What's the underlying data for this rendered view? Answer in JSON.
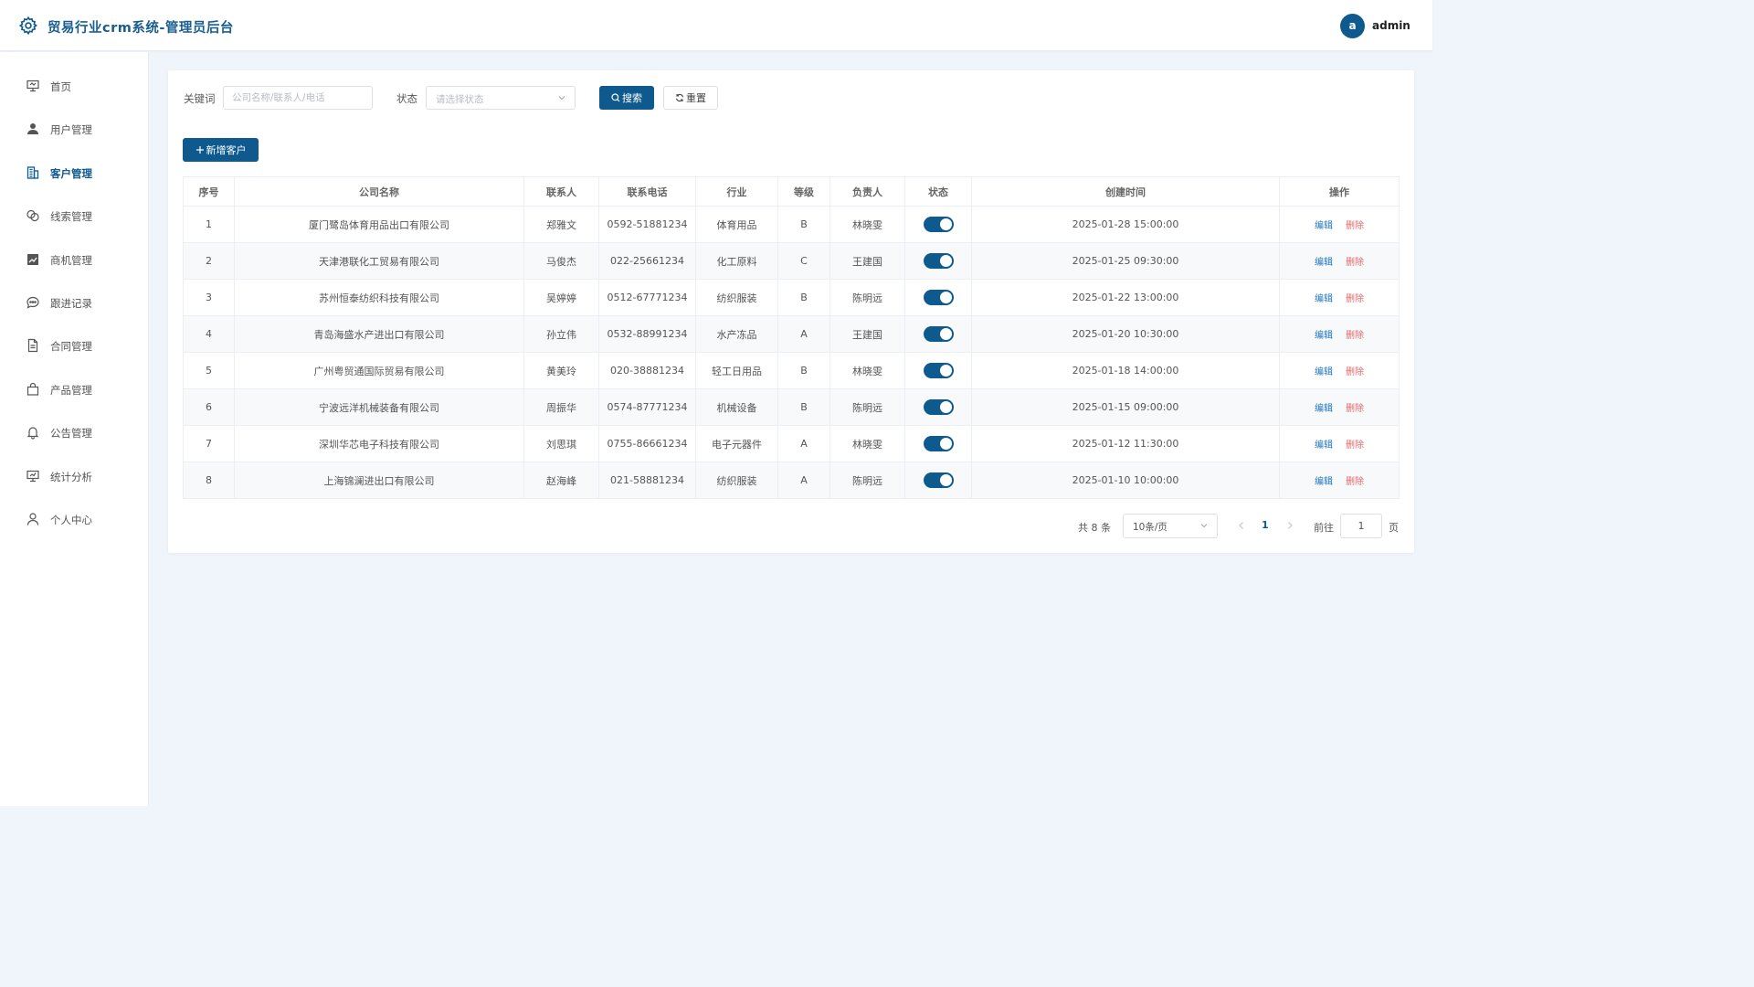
{
  "header": {
    "title": "贸易行业crm系统-管理员后台",
    "avatar_letter": "a",
    "username": "admin"
  },
  "sidebar": {
    "items": [
      {
        "label": "首页",
        "icon": "home-icon"
      },
      {
        "label": "用户管理",
        "icon": "user-icon"
      },
      {
        "label": "客户管理",
        "icon": "building-icon",
        "active": true
      },
      {
        "label": "线索管理",
        "icon": "clue-icon"
      },
      {
        "label": "商机管理",
        "icon": "trend-chart-icon"
      },
      {
        "label": "跟进记录",
        "icon": "chat-icon"
      },
      {
        "label": "合同管理",
        "icon": "document-icon"
      },
      {
        "label": "产品管理",
        "icon": "bag-icon"
      },
      {
        "label": "公告管理",
        "icon": "bell-icon"
      },
      {
        "label": "统计分析",
        "icon": "chart-board-icon"
      },
      {
        "label": "个人中心",
        "icon": "person-icon"
      }
    ]
  },
  "filters": {
    "keyword_label": "关键词",
    "keyword_placeholder": "公司名称/联系人/电话",
    "status_label": "状态",
    "status_placeholder": "请选择状态",
    "search_label": "搜索",
    "reset_label": "重置"
  },
  "add_button_label": "新增客户",
  "table": {
    "columns": [
      "序号",
      "公司名称",
      "联系人",
      "联系电话",
      "行业",
      "等级",
      "负责人",
      "状态",
      "创建时间",
      "操作"
    ],
    "edit_label": "编辑",
    "delete_label": "删除",
    "rows": [
      {
        "no": "1",
        "company": "厦门鹭岛体育用品出口有限公司",
        "contact": "郑雅文",
        "phone": "0592-51881234",
        "industry": "体育用品",
        "level": "B",
        "owner": "林晓雯",
        "status": true,
        "created": "2025-01-28 15:00:00"
      },
      {
        "no": "2",
        "company": "天津港联化工贸易有限公司",
        "contact": "马俊杰",
        "phone": "022-25661234",
        "industry": "化工原料",
        "level": "C",
        "owner": "王建国",
        "status": true,
        "created": "2025-01-25 09:30:00"
      },
      {
        "no": "3",
        "company": "苏州恒泰纺织科技有限公司",
        "contact": "吴婷婷",
        "phone": "0512-67771234",
        "industry": "纺织服装",
        "level": "B",
        "owner": "陈明远",
        "status": true,
        "created": "2025-01-22 13:00:00"
      },
      {
        "no": "4",
        "company": "青岛海盛水产进出口有限公司",
        "contact": "孙立伟",
        "phone": "0532-88991234",
        "industry": "水产冻品",
        "level": "A",
        "owner": "王建国",
        "status": true,
        "created": "2025-01-20 10:30:00"
      },
      {
        "no": "5",
        "company": "广州粤贸通国际贸易有限公司",
        "contact": "黄美玲",
        "phone": "020-38881234",
        "industry": "轻工日用品",
        "level": "B",
        "owner": "林晓雯",
        "status": true,
        "created": "2025-01-18 14:00:00"
      },
      {
        "no": "6",
        "company": "宁波远洋机械装备有限公司",
        "contact": "周振华",
        "phone": "0574-87771234",
        "industry": "机械设备",
        "level": "B",
        "owner": "陈明远",
        "status": true,
        "created": "2025-01-15 09:00:00"
      },
      {
        "no": "7",
        "company": "深圳华芯电子科技有限公司",
        "contact": "刘思琪",
        "phone": "0755-86661234",
        "industry": "电子元器件",
        "level": "A",
        "owner": "林晓雯",
        "status": true,
        "created": "2025-01-12 11:30:00"
      },
      {
        "no": "8",
        "company": "上海锦澜进出口有限公司",
        "contact": "赵海峰",
        "phone": "021-58881234",
        "industry": "纺织服装",
        "level": "A",
        "owner": "陈明远",
        "status": true,
        "created": "2025-01-10 10:00:00"
      }
    ]
  },
  "pagination": {
    "total_text": "共 8 条",
    "page_size": "10条/页",
    "current_page": "1",
    "goto_label": "前往",
    "goto_value": "1",
    "page_suffix": "页"
  },
  "colors": {
    "primary": "#0e5a8e",
    "delete": "#e06a6a",
    "edit": "#1f77c0",
    "background": "#f0f5fb"
  }
}
